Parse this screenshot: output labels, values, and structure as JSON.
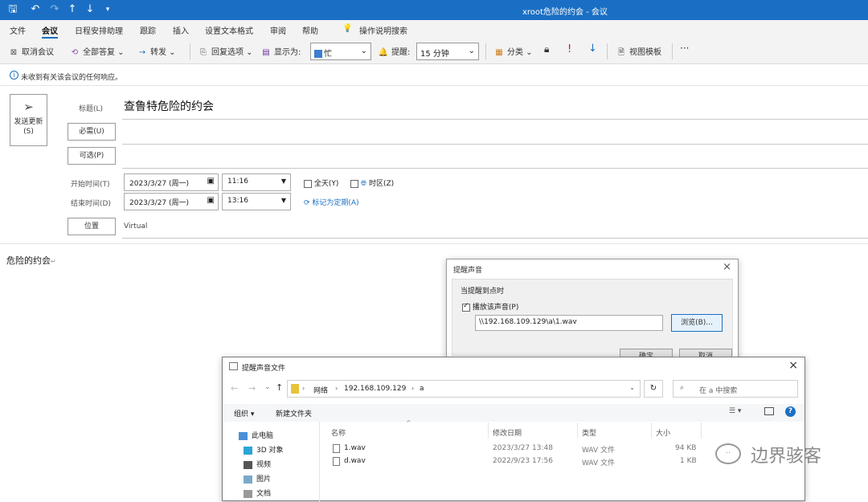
{
  "window": {
    "title": "xroot危险的约会  -  会议"
  },
  "menu": [
    "文件",
    "会议",
    "日程安排助理",
    "跟踪",
    "插入",
    "设置文本格式",
    "审阅",
    "帮助",
    "操作说明搜索"
  ],
  "ribbon": {
    "cancel": "取消会议",
    "reply_all": "全部答复",
    "forward": "转发",
    "reply_options": "回复选项",
    "show_as_label": "显示为:",
    "show_as_value": "忙",
    "reminder_label": "提醒:",
    "reminder_value": "15 分钟",
    "categorize": "分类",
    "view_template": "视图模板",
    "more": "···"
  },
  "info": "未收到有关该会议的任何响应。",
  "send_update": "发送更新(S)",
  "form": {
    "title_label": "标题(L)",
    "title_value": "查鲁特危险的约会",
    "required_btn": "必需(U)",
    "optional_btn": "可选(P)",
    "start_label": "开始时间(T)",
    "start_date": "2023/3/27 (周一)",
    "start_time": "11:16",
    "all_day": "全天(Y)",
    "timezone": "时区(Z)",
    "end_label": "结束时间(D)",
    "end_date": "2023/3/27 (周一)",
    "end_time": "13:16",
    "recurring": "标记为定期(A)",
    "location_btn": "位置",
    "location_value": "Virtual"
  },
  "body_text": "危险的约会",
  "sound_dialog": {
    "title": "提醒声音",
    "group": "当提醒到点时",
    "play_sound": "播放该声音(P)",
    "path": "\\\\192.168.109.129\\a\\1.wav",
    "browse": "浏览(B)...",
    "ok": "确定",
    "cancel": "取消"
  },
  "file_dialog": {
    "title": "提醒声音文件",
    "breadcrumb": [
      "网络",
      "192.168.109.129",
      "a"
    ],
    "search_placeholder": "在 a 中搜索",
    "organize": "组织",
    "new_folder": "新建文件夹",
    "tree": [
      "此电脑",
      "3D 对象",
      "视频",
      "图片",
      "文档"
    ],
    "columns": [
      "名称",
      "修改日期",
      "类型",
      "大小"
    ],
    "files": [
      {
        "name": "1.wav",
        "date": "2023/3/27 13:48",
        "type": "WAV 文件",
        "size": "94 KB"
      },
      {
        "name": "d.wav",
        "date": "2022/9/23 17:56",
        "type": "WAV 文件",
        "size": "1 KB"
      }
    ]
  },
  "watermark": "边界骇客"
}
